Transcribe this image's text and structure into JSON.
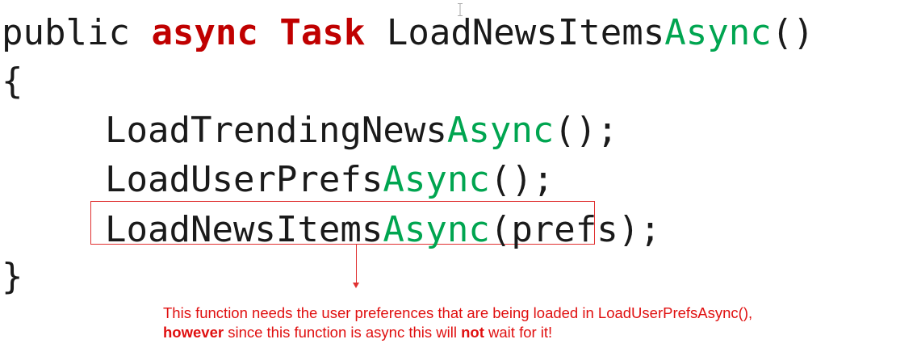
{
  "code": {
    "line1": {
      "a": "public ",
      "b": "async",
      "c": " ",
      "d": "Task",
      "e": " LoadNewsItems",
      "f": "Async",
      "g": "()"
    },
    "line2": {
      "text": "{"
    },
    "line3": {
      "a": "LoadTrendingNews",
      "b": "Async",
      "c": "();"
    },
    "line4": {
      "a": "LoadUserPrefs",
      "b": "Async",
      "c": "();"
    },
    "line5": {
      "a": "LoadNewsItems",
      "b": "Async",
      "c": "(prefs);"
    },
    "line6": {
      "text": "}"
    }
  },
  "annotation": {
    "line1": "This function needs the user preferences that are being loaded in LoadUserPrefsAsync(),",
    "however": "however",
    "middle": " since this function is async this will ",
    "not": "not",
    "end": " wait for it!"
  },
  "colors": {
    "keyword": "#c00000",
    "async_suffix": "#00a550",
    "annotation": "#e01010",
    "highlight_border": "#e03030"
  },
  "icons": {
    "cursor": "text-cursor-icon"
  }
}
